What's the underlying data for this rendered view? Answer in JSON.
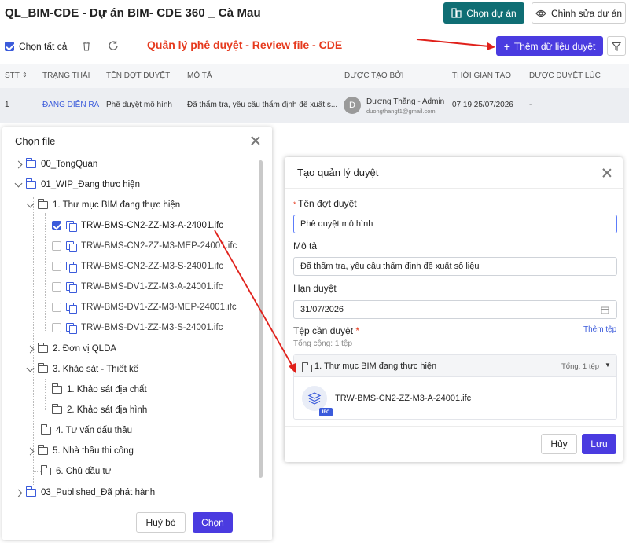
{
  "header": {
    "title": "QL_BIM-CDE - Dự án BIM- CDE 360 _ Cà Mau",
    "pick_project": "Chọn dự án",
    "edit_project": "Chỉnh sửa dự án"
  },
  "toolbar": {
    "select_all": "Chọn tất cả",
    "annotation": "Quản lý phê duyệt - Review file - CDE",
    "add_button": "Thêm dữ liệu duyệt"
  },
  "table": {
    "columns": [
      "STT",
      "TRẠNG THÁI",
      "TÊN ĐỢT DUYỆT",
      "MÔ TẢ",
      "ĐƯỢC TẠO BỞI",
      "THỜI GIAN TẠO",
      "ĐƯỢC DUYỆT LÚC"
    ],
    "row": {
      "stt": "1",
      "status": "ĐANG DIỄN RA",
      "name": "Phê duyệt mô hình",
      "desc": "Đã thẩm tra, yêu cầu thẩm định đề xuất s...",
      "avatar": "D",
      "creator": "Dương Thắng - Admin",
      "email": "duongthangf1@gmail.com",
      "created": "07:19 25/07/2026",
      "approved": "-"
    }
  },
  "file_dialog": {
    "title": "Chọn file",
    "tree": [
      "00_TongQuan",
      "01_WIP_Đang thực hiện",
      "1. Thư mục BIM đang thực hiện",
      "TRW-BMS-CN2-ZZ-M3-A-24001.ifc",
      "TRW-BMS-CN2-ZZ-M3-MEP-24001.ifc",
      "TRW-BMS-CN2-ZZ-M3-S-24001.ifc",
      "TRW-BMS-DV1-ZZ-M3-A-24001.ifc",
      "TRW-BMS-DV1-ZZ-M3-MEP-24001.ifc",
      "TRW-BMS-DV1-ZZ-M3-S-24001.ifc",
      "2. Đơn vị QLDA",
      "3. Khảo sát - Thiết kế",
      "1. Khảo sát địa chất",
      "2. Khảo sát địa hình",
      "4. Tư vấn đấu thầu",
      "5. Nhà thầu thi công",
      "6. Chủ đầu tư",
      "03_Published_Đã phát hành"
    ],
    "cancel": "Huỷ bỏ",
    "confirm": "Chọn"
  },
  "create_dialog": {
    "title": "Tạo quản lý duyệt",
    "name_label": "Tên đợt duyệt",
    "name_value": "Phê duyệt mô hình",
    "desc_label": "Mô tả",
    "desc_value": "Đã thẩm tra, yêu cầu thẩm định đề xuất số liệu",
    "deadline_label": "Hạn duyệt",
    "deadline_value": "31/07/2026",
    "files_label": "Tệp cần duyệt",
    "add_file": "Thêm tệp",
    "total": "Tổng cộng: 1 tệp",
    "folder": "1. Thư mục BIM đang thực hiện",
    "folder_total": "Tổng: 1 tệp",
    "file_name": "TRW-BMS-CN2-ZZ-M3-A-24001.ifc",
    "file_badge": "IFC",
    "cancel": "Hủy",
    "save": "Lưu"
  },
  "colors": {
    "primary": "#4a3be0",
    "teal": "#0f6e74",
    "annotation_red": "#e63a1e"
  }
}
